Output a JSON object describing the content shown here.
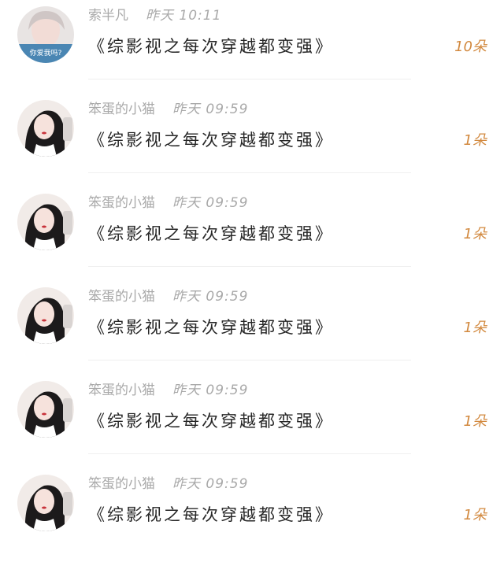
{
  "comments": [
    {
      "user": "索半凡",
      "time": "昨天 10:11",
      "title": "《综影视之每次穿越都变强》",
      "count": "10朵",
      "avatar": {
        "icon": "avatar-snow-girl-icon",
        "caption": "你爱我吗?"
      }
    },
    {
      "user": "笨蛋的小猫",
      "time": "昨天 09:59",
      "title": "《综影视之每次穿越都变强》",
      "count": "1朵",
      "avatar": {
        "icon": "avatar-dark-hair-girl-icon"
      }
    },
    {
      "user": "笨蛋的小猫",
      "time": "昨天 09:59",
      "title": "《综影视之每次穿越都变强》",
      "count": "1朵",
      "avatar": {
        "icon": "avatar-dark-hair-girl-icon"
      }
    },
    {
      "user": "笨蛋的小猫",
      "time": "昨天 09:59",
      "title": "《综影视之每次穿越都变强》",
      "count": "1朵",
      "avatar": {
        "icon": "avatar-dark-hair-girl-icon"
      }
    },
    {
      "user": "笨蛋的小猫",
      "time": "昨天 09:59",
      "title": "《综影视之每次穿越都变强》",
      "count": "1朵",
      "avatar": {
        "icon": "avatar-dark-hair-girl-icon"
      }
    },
    {
      "user": "笨蛋的小猫",
      "time": "昨天 09:59",
      "title": "《综影视之每次穿越都变强》",
      "count": "1朵",
      "avatar": {
        "icon": "avatar-dark-hair-girl-icon"
      }
    }
  ],
  "colors": {
    "count": "#d2893f",
    "meta": "#a9a9a9",
    "title": "#262626"
  }
}
